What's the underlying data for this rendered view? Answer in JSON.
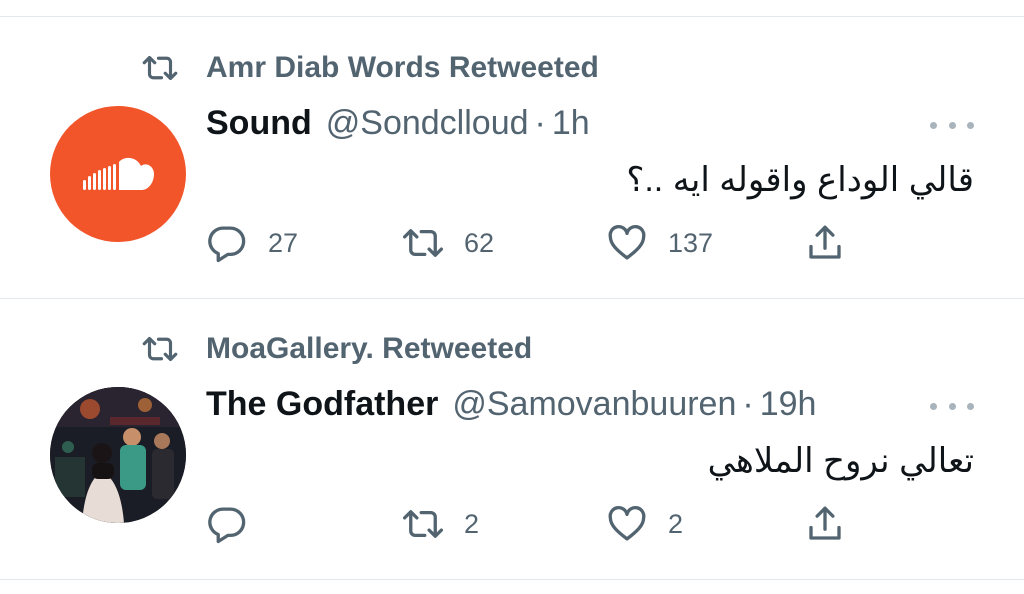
{
  "tweets": [
    {
      "retweeted_by": "Amr Diab Words Retweeted",
      "avatar_icon": "soundcloud-logo-icon",
      "avatar_color": "#f2552a",
      "name": "Sound",
      "handle": "@Sondclloud",
      "separator": "·",
      "time": "1h",
      "text": "قالي الوداع واقوله ايه ..؟",
      "replies": "27",
      "retweets": "62",
      "likes": "137"
    },
    {
      "retweeted_by": "MoaGallery. Retweeted",
      "avatar_icon": "party-photo-avatar",
      "name": "The Godfather",
      "handle": "@Samovanbuuren",
      "separator": "·",
      "time": "19h",
      "text": "تعالي نروح الملاهي",
      "replies": "",
      "retweets": "2",
      "likes": "2"
    }
  ],
  "colors": {
    "secondary_text": "#536471",
    "divider": "#e3e8ec",
    "primary_text": "#0f1419"
  }
}
